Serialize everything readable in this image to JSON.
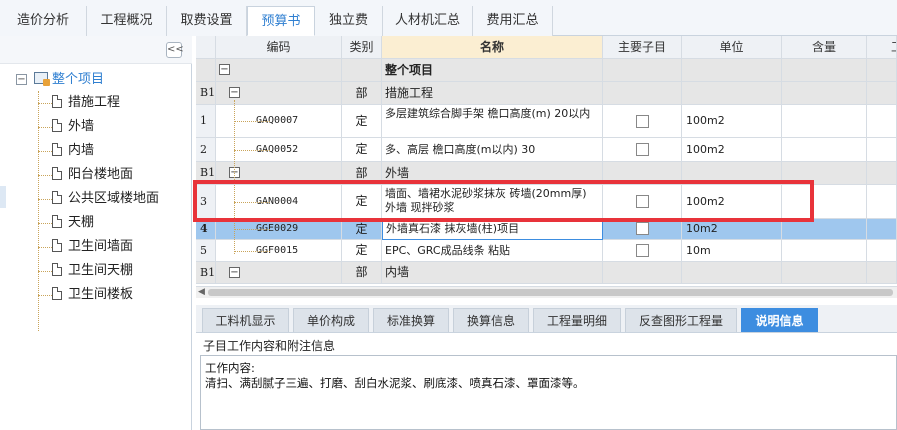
{
  "top_tabs": [
    {
      "label": "造价分析"
    },
    {
      "label": "工程概况"
    },
    {
      "label": "取费设置"
    },
    {
      "label": "预算书",
      "active": true
    },
    {
      "label": "独立费"
    },
    {
      "label": "人材机汇总"
    },
    {
      "label": "费用汇总"
    }
  ],
  "tree": {
    "collapse_label": "<<",
    "root_toggle": "−",
    "root_label": "整个项目",
    "items": [
      "措施工程",
      "外墙",
      "内墙",
      "阳台楼地面",
      "公共区域楼地面",
      "天棚",
      "卫生间墙面",
      "卫生间天棚",
      "卫生间楼板"
    ]
  },
  "grid": {
    "headers": {
      "code": "编码",
      "type": "类别",
      "name": "名称",
      "main": "主要子目",
      "unit": "单位",
      "qty": "含量",
      "extra": "工"
    },
    "rows": [
      {
        "num": "",
        "code": "",
        "type": "",
        "name": "整个项目",
        "unit": "",
        "kind": "root"
      },
      {
        "num": "B1",
        "code": "",
        "type": "部",
        "name": "措施工程",
        "unit": "",
        "kind": "group"
      },
      {
        "num": "1",
        "code": "GAQ0007",
        "type": "定",
        "name": "多层建筑综合脚手架 檐口高度(m) 20以内",
        "unit": "100m2",
        "kind": "item"
      },
      {
        "num": "2",
        "code": "GAQ0052",
        "type": "定",
        "name": "多、高层 檐口高度(m以内) 30",
        "unit": "100m2",
        "kind": "item"
      },
      {
        "num": "B1",
        "code": "",
        "type": "部",
        "name": "外墙",
        "unit": "",
        "kind": "group"
      },
      {
        "num": "3",
        "code": "GAN0004",
        "type": "定",
        "name": "墙面、墙裙水泥砂浆抹灰 砖墙(20mm厚) 外墙 现拌砂浆",
        "unit": "100m2",
        "kind": "item"
      },
      {
        "num": "4",
        "code": "GGE0029",
        "type": "定",
        "name": "外墙真石漆 抹灰墙(柱)项目",
        "unit": "10m2",
        "kind": "selected"
      },
      {
        "num": "5",
        "code": "GGF0015",
        "type": "定",
        "name": "EPC、GRC成品线条 粘贴",
        "unit": "10m",
        "kind": "item"
      },
      {
        "num": "B1",
        "code": "",
        "type": "部",
        "name": "内墙",
        "unit": "",
        "kind": "group"
      }
    ]
  },
  "bottom_tabs": [
    {
      "label": "工料机显示"
    },
    {
      "label": "单价构成"
    },
    {
      "label": "标准换算"
    },
    {
      "label": "换算信息"
    },
    {
      "label": "工程量明细"
    },
    {
      "label": "反查图形工程量"
    },
    {
      "label": "说明信息",
      "active": true
    }
  ],
  "info": {
    "title": "子目工作内容和附注信息",
    "line1": "工作内容:",
    "line2": "清扫、满刮腻子三遍、打磨、刮白水泥浆、刷底漆、喷真石漆、罩面漆等。"
  },
  "colors": {
    "accent": "#2f7fd1",
    "selected_row": "#9fc7ee",
    "highlight_box": "#e8333a",
    "active_bottom_tab": "#3d8de0"
  }
}
